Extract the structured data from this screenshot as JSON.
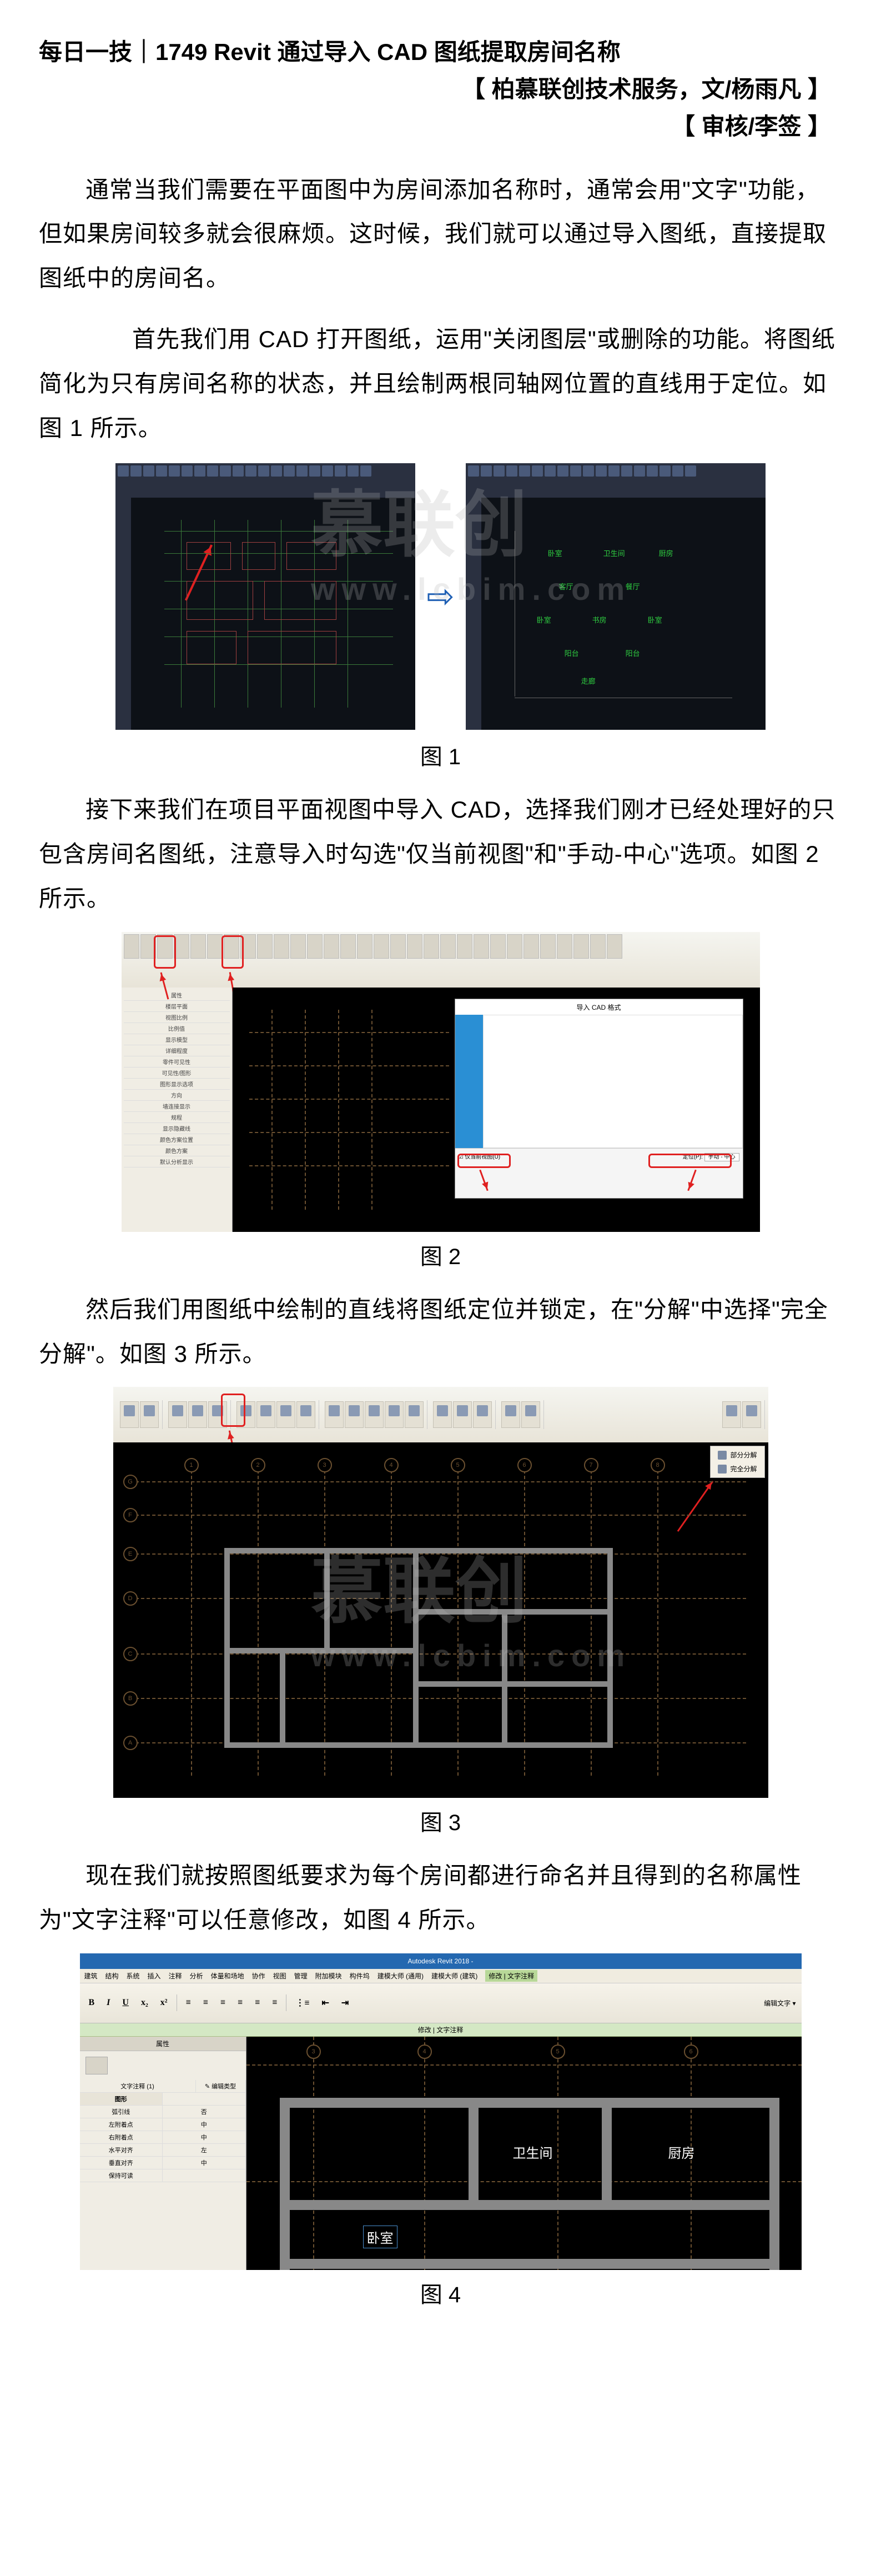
{
  "title": "每日一技｜1749 Revit 通过导入 CAD 图纸提取房间名称",
  "subtitle1": "【 柏慕联创技术服务，文/杨雨凡 】",
  "subtitle2": "【 审核/李签 】",
  "watermark_main": "慕联创",
  "watermark_sub": "www.lcbim.com",
  "para1": "通常当我们需要在平面图中为房间添加名称时，通常会用\"文字\"功能，但如果房间较多就会很麻烦。这时候，我们就可以通过导入图纸，直接提取图纸中的房间名。",
  "para2": "首先我们用 CAD 打开图纸，运用\"关闭图层\"或删除的功能。将图纸简化为只有房间名称的状态，并且绘制两根同轴网位置的直线用于定位。如图 1 所示。",
  "cap1": "图 1",
  "para3": "接下来我们在项目平面视图中导入 CAD，选择我们刚才已经处理好的只包含房间名图纸，注意导入时勾选\"仅当前视图\"和\"手动-中心\"选项。如图 2 所示。",
  "cap2": "图 2",
  "para4": "然后我们用图纸中绘制的直线将图纸定位并锁定，在\"分解\"中选择\"完全分解\"。如图 3 所示。",
  "cap3": "图 3",
  "para5": "现在我们就按照图纸要求为每个房间都进行命名并且得到的名称属性为\"文字注释\"可以任意修改，如图 4 所示。",
  "cap4": "图 4",
  "fig2": {
    "dialog_title": "导入 CAD 格式",
    "checkbox": "☑ 仅当前视图(U)",
    "pos_label": "定位(P):",
    "pos_value": "手动 - 中心"
  },
  "fig3": {
    "dd1": "部分分解",
    "dd2": "完全分解"
  },
  "fig4": {
    "app_title": "Autodesk Revit 2018 -",
    "menu": [
      "建筑",
      "结构",
      "系统",
      "插入",
      "注释",
      "分析",
      "体量和场地",
      "协作",
      "视图",
      "管理",
      "附加模块",
      "构件坞",
      "建模大师 (通用)",
      "建模大师 (建筑)",
      "修改 | 文字注释"
    ],
    "ribbon_label": "编辑文字 ▾",
    "modify_tab": "修改 | 文字注释",
    "props_title": "属性",
    "type_label": "文字注释 (1)",
    "edit_type": "✎ 编辑类型",
    "rows": [
      [
        "图形",
        ""
      ],
      [
        "弧引线",
        "否"
      ],
      [
        "左附着点",
        "中"
      ],
      [
        "右附着点",
        "中"
      ],
      [
        "水平对齐",
        "左"
      ],
      [
        "垂直对齐",
        "中"
      ],
      [
        "保持可读",
        ""
      ]
    ],
    "rooms": {
      "r1": "卫生间",
      "r2": "厨房",
      "r3": "卧室"
    }
  }
}
